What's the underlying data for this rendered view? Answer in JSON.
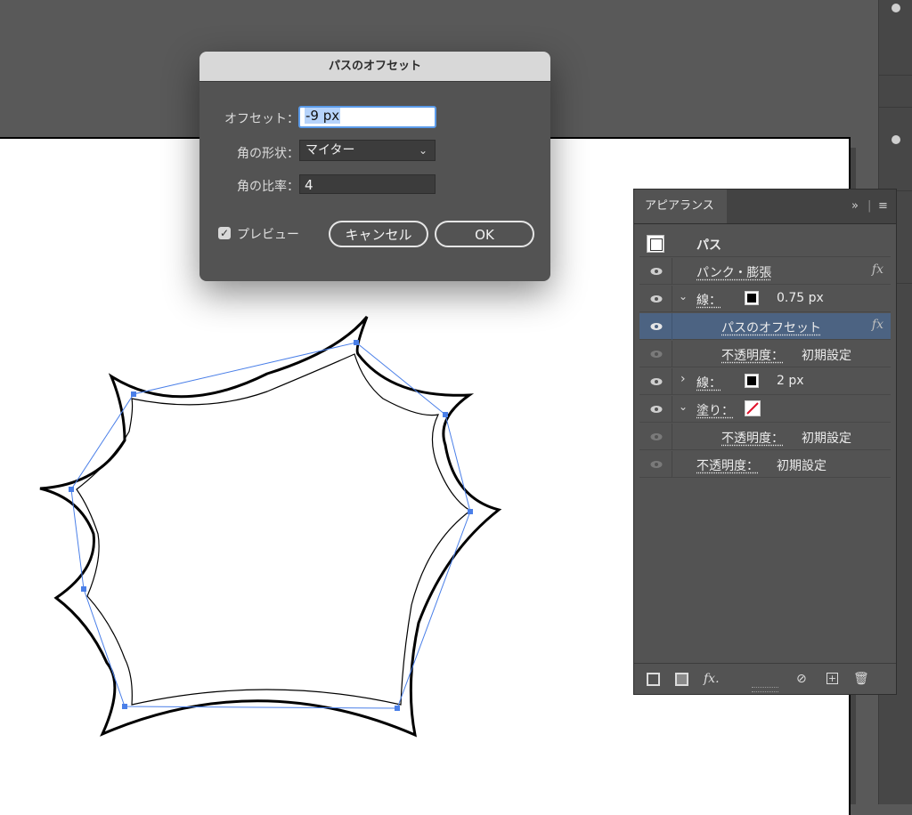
{
  "dialog": {
    "title": "パスのオフセット",
    "offset_label": "オフセット：",
    "offset_value": "-9 px",
    "joins_label": "角の形状：",
    "joins_value": "マイター",
    "miter_label": "角の比率：",
    "miter_value": "4",
    "preview_label": "プレビュー",
    "preview_checked": true,
    "cancel_label": "キャンセル",
    "ok_label": "OK"
  },
  "panel": {
    "tab": "アピアランス",
    "header_label": "パス",
    "rows": [
      {
        "label": "パンク・膨張",
        "fx": "fx"
      },
      {
        "twisty": "⌄",
        "label": "線：",
        "value": "0.75 px"
      },
      {
        "label": "パスのオフセット",
        "fx": "fx",
        "selected": true
      },
      {
        "label": "不透明度：",
        "value": "初期設定"
      },
      {
        "twisty": "›",
        "label": "線：",
        "value": "2 px"
      },
      {
        "twisty": "⌄",
        "label": "塗り："
      },
      {
        "label": "不透明度：",
        "value": "初期設定"
      },
      {
        "label": "不透明度：",
        "value": "初期設定"
      }
    ],
    "footer_icons": [
      "new-stroke-icon",
      "new-fill-icon",
      "fx-icon",
      "clear-icon",
      "duplicate-icon",
      "trash-icon"
    ]
  },
  "colors": {
    "selection_blue": "#4a7fe8",
    "panel_highlight": "#4c6382",
    "fill_none_red": "#e0122b"
  }
}
